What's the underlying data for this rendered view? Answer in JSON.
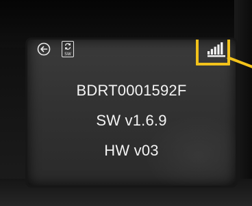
{
  "display": {
    "serial": "BDRT0001592F",
    "software_version": "SW v1.6.9",
    "hardware_version": "HW v03",
    "sw_icon_label": "SW"
  },
  "icons": {
    "back": "back-arrow-circle-icon",
    "software_update": "software-update-icon",
    "signal": "signal-strength-icon"
  },
  "signal": {
    "bars_filled": 5,
    "bars_total": 5
  },
  "annotation": {
    "highlight_color": "#f2c21b"
  },
  "colors": {
    "screen_bg": "#333333",
    "text": "#f4f4f4"
  }
}
